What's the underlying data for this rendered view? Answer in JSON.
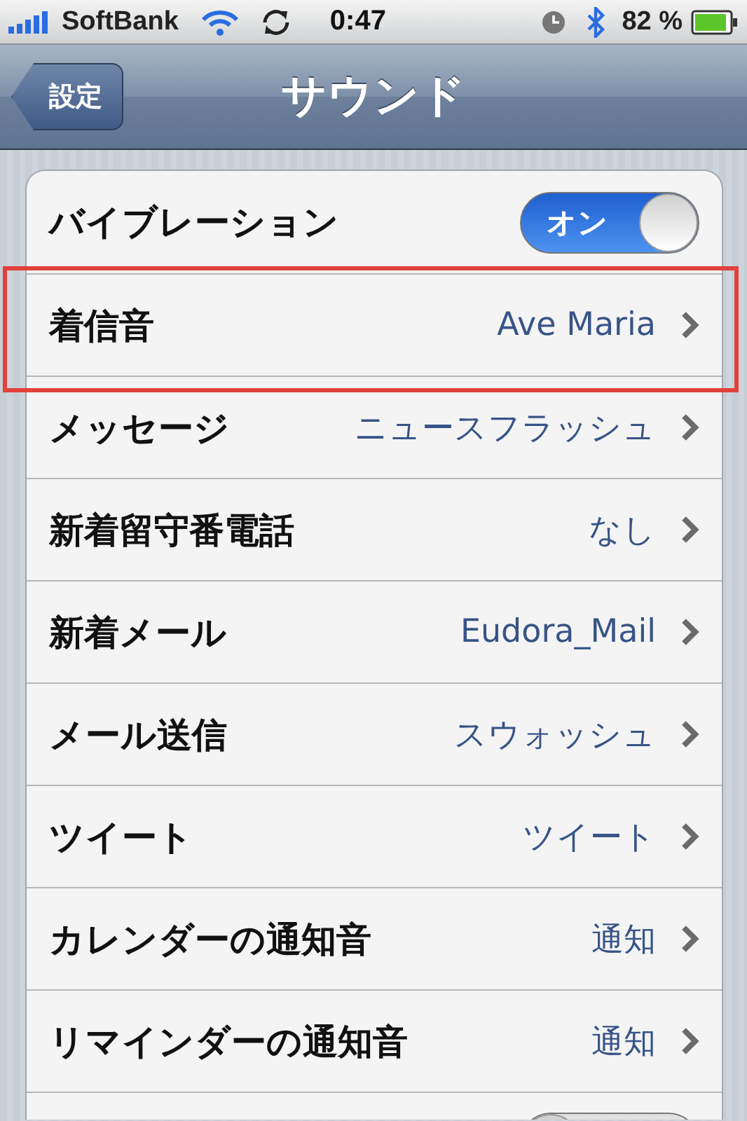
{
  "status_bar": {
    "carrier": "SoftBank",
    "time": "0:47",
    "battery": "82 %"
  },
  "nav": {
    "back": "設定",
    "title": "サウンド"
  },
  "rows": [
    {
      "kind": "switch",
      "label": "バイブレーション",
      "on": true,
      "switch_label": "オン",
      "highlighted": false
    },
    {
      "kind": "link",
      "label": "着信音",
      "value": "Ave Maria",
      "highlighted": true
    },
    {
      "kind": "link",
      "label": "メッセージ",
      "value": "ニュースフラッシュ",
      "highlighted": false
    },
    {
      "kind": "link",
      "label": "新着留守番電話",
      "value": "なし",
      "highlighted": false
    },
    {
      "kind": "link",
      "label": "新着メール",
      "value": "Eudora_Mail",
      "highlighted": false
    },
    {
      "kind": "link",
      "label": "メール送信",
      "value": "スウォッシュ",
      "highlighted": false
    },
    {
      "kind": "link",
      "label": "ツイート",
      "value": "ツイート",
      "highlighted": false
    },
    {
      "kind": "link",
      "label": "カレンダーの通知音",
      "value": "通知",
      "highlighted": false
    },
    {
      "kind": "link",
      "label": "リマインダーの通知音",
      "value": "通知",
      "highlighted": false
    },
    {
      "kind": "switch",
      "on": false,
      "highlighted": false
    }
  ]
}
